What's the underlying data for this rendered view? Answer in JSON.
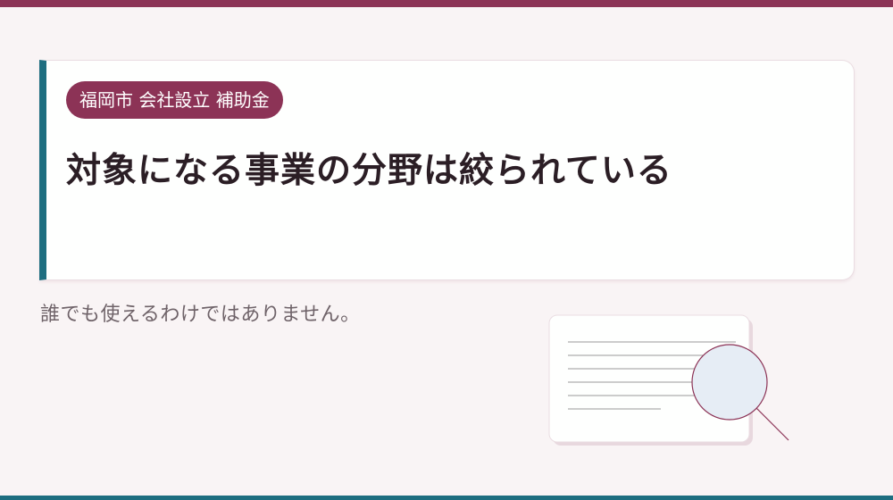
{
  "slide": {
    "tag": "福岡市 会社設立 補助金",
    "title": "対象になる事業の分野は絞られている",
    "subtext": "誰でも使えるわけではありません。"
  },
  "illustration": {
    "icon": "document-magnifier-icon"
  },
  "colors": {
    "accent": "#8c3356",
    "secondary": "#1e6e80",
    "background": "#f9f4f5",
    "title_text": "#2b1e25",
    "body_text": "#6f6369"
  }
}
